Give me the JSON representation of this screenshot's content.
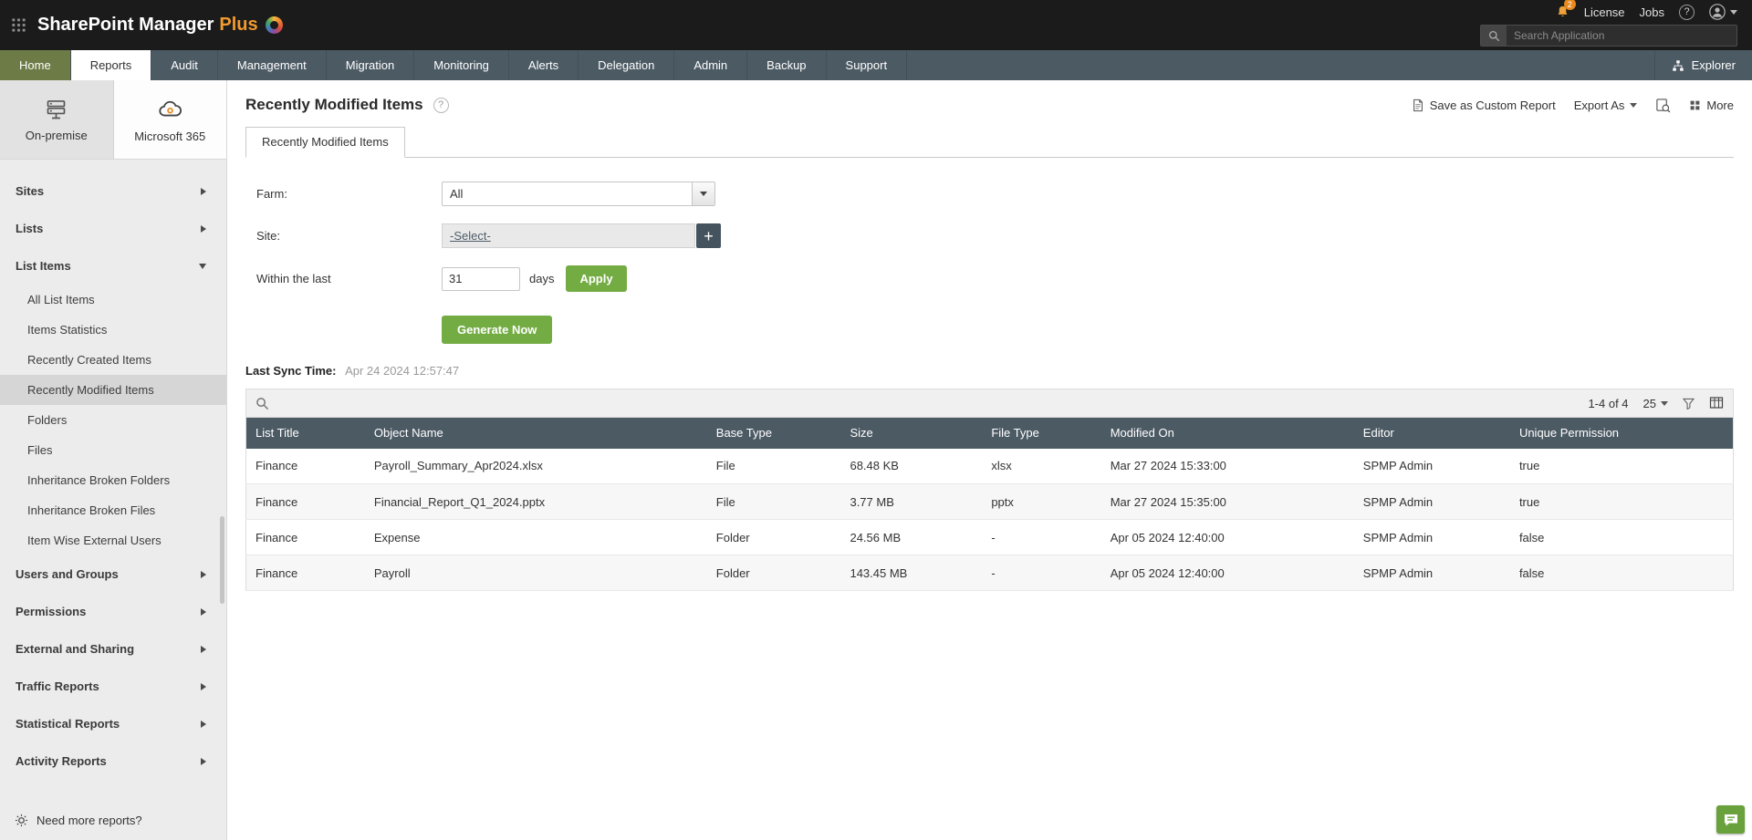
{
  "topbar": {
    "logo_main": "SharePoint Manager",
    "logo_accent": "Plus",
    "notification_count": "2",
    "license_label": "License",
    "jobs_label": "Jobs",
    "search_placeholder": "Search Application"
  },
  "icons": {
    "help": "?",
    "add": "+"
  },
  "nav": {
    "tabs": [
      "Home",
      "Reports",
      "Audit",
      "Management",
      "Migration",
      "Monitoring",
      "Alerts",
      "Delegation",
      "Admin",
      "Backup",
      "Support"
    ],
    "active_tab": "Reports",
    "explorer_label": "Explorer"
  },
  "sidebar": {
    "mode_onpremise": "On-premise",
    "mode_m365": "Microsoft 365",
    "active_mode": "Microsoft 365",
    "item_sites": "Sites",
    "item_lists": "Lists",
    "item_list_items": "List Items",
    "list_items_children": [
      "All List Items",
      "Items Statistics",
      "Recently Created Items",
      "Recently Modified Items",
      "Folders",
      "Files",
      "Inheritance Broken Folders",
      "Inheritance Broken Files",
      "Item Wise External Users"
    ],
    "selected_child": "Recently Modified Items",
    "item_users_groups": "Users and Groups",
    "item_permissions": "Permissions",
    "item_external_sharing": "External and Sharing",
    "item_traffic": "Traffic Reports",
    "item_statistical": "Statistical Reports",
    "item_activity": "Activity Reports",
    "footer_label": "Need more reports?"
  },
  "main": {
    "title": "Recently Modified Items",
    "actions": {
      "save_as_custom_report": "Save as Custom Report",
      "export_as": "Export As",
      "more": "More"
    },
    "tab_label": "Recently Modified Items",
    "form": {
      "farm_label": "Farm:",
      "farm_value": "All",
      "site_label": "Site:",
      "site_value": "-Select-",
      "within_label": "Within the last",
      "within_value": "31",
      "days_label": "days",
      "apply_label": "Apply",
      "generate_label": "Generate Now"
    },
    "last_sync_label": "Last Sync Time:",
    "last_sync_value": "Apr 24 2024 12:57:47",
    "table": {
      "pagination": "1-4 of 4",
      "page_size": "25",
      "columns": [
        "List Title",
        "Object Name",
        "Base Type",
        "Size",
        "File Type",
        "Modified On",
        "Editor",
        "Unique Permission"
      ],
      "rows": [
        [
          "Finance",
          "Payroll_Summary_Apr2024.xlsx",
          "File",
          "68.48 KB",
          "xlsx",
          "Mar 27 2024 15:33:00",
          "SPMP Admin",
          "true"
        ],
        [
          "Finance",
          "Financial_Report_Q1_2024.pptx",
          "File",
          "3.77 MB",
          "pptx",
          "Mar 27 2024 15:35:00",
          "SPMP Admin",
          "true"
        ],
        [
          "Finance",
          "Expense",
          "Folder",
          "24.56 MB",
          "-",
          "Apr 05 2024 12:40:00",
          "SPMP Admin",
          "false"
        ],
        [
          "Finance",
          "Payroll",
          "Folder",
          "143.45 MB",
          "-",
          "Apr 05 2024 12:40:00",
          "SPMP Admin",
          "false"
        ]
      ]
    }
  },
  "colors": {
    "topbar_bg": "#1b1b1b",
    "nav_bg": "#4c5a64",
    "home_tab_bg": "#6d7b46",
    "accent_green": "#74ac44",
    "table_header_bg": "#4c5a64",
    "badge_orange": "#e8881c",
    "logo_accent": "#f29a2e"
  }
}
